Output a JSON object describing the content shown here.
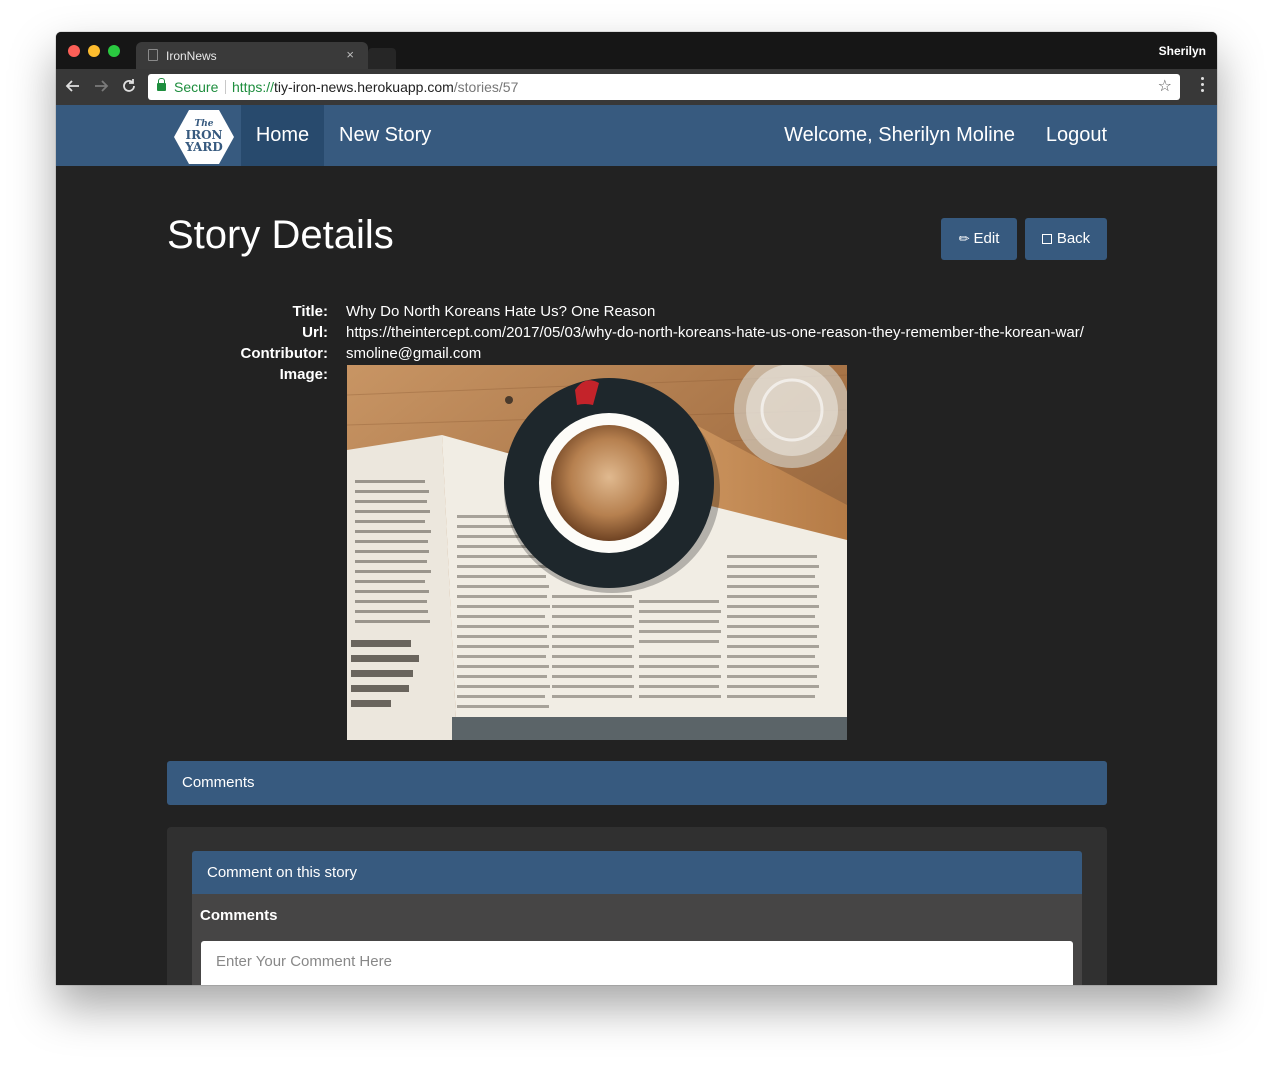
{
  "browser": {
    "tab_title": "IronNews",
    "tab_close": "×",
    "profile_name": "Sherilyn",
    "secure_label": "Secure",
    "url_scheme": "https://",
    "url_host": "tiy-iron-news.herokuapp.com",
    "url_path": "/stories/57",
    "icons": [
      "back-arrow-icon",
      "forward-arrow-icon",
      "reload-icon",
      "lock-icon",
      "star-icon",
      "menu-icon",
      "page-icon"
    ]
  },
  "navbar": {
    "logo_line1": "The",
    "logo_line2": "IRON",
    "logo_line3": "YARD",
    "home": "Home",
    "new_story": "New Story",
    "welcome": "Welcome, Sherilyn Moline",
    "logout": "Logout",
    "color": "#375a7f",
    "active_color": "#284a6d"
  },
  "main": {
    "heading": "Story Details",
    "edit_label": "Edit",
    "back_label": "Back",
    "details": {
      "title_label": "Title:",
      "title": "Why Do North Koreans Hate Us? One Reason",
      "url_label": "Url:",
      "url": "https://theintercept.com/2017/05/03/why-do-north-koreans-hate-us-one-reason-they-remember-the-korean-war/",
      "contributor_label": "Contributor:",
      "contributor": "smoline@gmail.com",
      "image_label": "Image:"
    }
  },
  "comments": {
    "header": "Comments",
    "panel_title": "Comment on this story",
    "form_label": "Comments",
    "placeholder": "Enter Your Comment Here"
  },
  "colors": {
    "page_background": "#222222",
    "accent": "#375a7f",
    "panel_body": "#464545",
    "well": "#303030"
  }
}
